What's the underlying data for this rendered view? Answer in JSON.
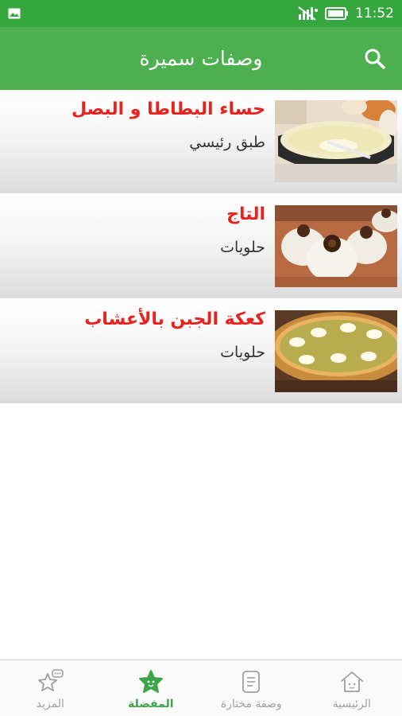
{
  "status_bar": {
    "time": "11:52",
    "icons": [
      "image-notification-icon",
      "no-sim-signal-icon",
      "battery-icon"
    ]
  },
  "app_bar": {
    "title": "وصفات سميرة",
    "search_icon": "search-icon"
  },
  "recipes": [
    {
      "title": "حساء البطاطا و البصل",
      "category": "طبق رئيسي",
      "image": "potato-onion-soup-photo"
    },
    {
      "title": "التاج",
      "category": "حلويات",
      "image": "taj-sweets-photo"
    },
    {
      "title": "كعكة الجبن بالأعشاب",
      "category": "حلويات",
      "image": "herb-cheesecake-photo"
    }
  ],
  "bottom_nav": {
    "items": [
      {
        "label": "الرئيسية",
        "icon": "home-icon",
        "active": false
      },
      {
        "label": "وصفة مختارة",
        "icon": "document-icon",
        "active": false
      },
      {
        "label": "المفضلة",
        "icon": "star-icon",
        "active": true
      },
      {
        "label": "المزيد",
        "icon": "star-chat-icon",
        "active": false
      }
    ]
  },
  "colors": {
    "status_bar": "#36a73f",
    "app_bar": "#4cb050",
    "recipe_title": "#e8231d",
    "nav_active": "#3ea547",
    "nav_inactive": "#a0a0a0"
  }
}
